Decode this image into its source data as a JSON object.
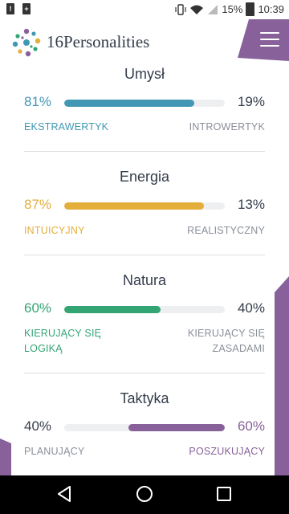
{
  "status_bar": {
    "battery": "15%",
    "time": "10:39"
  },
  "header": {
    "brand": "16Personalities"
  },
  "colors": {
    "mind": "#4298b4",
    "energy": "#e4ae3a",
    "nature": "#33a474",
    "tactics": "#88619a",
    "muted": "#8a8f99"
  },
  "traits": [
    {
      "title": "Umysł",
      "left_pct": "81%",
      "right_pct": "19%",
      "fill": 0.81,
      "fill_side": "left",
      "left_label": "EKSTRAWERTYK",
      "right_label": "INTROWERTYK"
    },
    {
      "title": "Energia",
      "left_pct": "87%",
      "right_pct": "13%",
      "fill": 0.87,
      "fill_side": "left",
      "left_label": "INTUICYJNY",
      "right_label": "REALISTYCZNY"
    },
    {
      "title": "Natura",
      "left_pct": "60%",
      "right_pct": "40%",
      "fill": 0.6,
      "fill_side": "left",
      "left_label_lines": [
        "KIERUJĄCY SIĘ",
        "LOGIKĄ"
      ],
      "right_label_lines": [
        "KIERUJĄCY SIĘ",
        "ZASADAMI"
      ]
    },
    {
      "title": "Taktyka",
      "left_pct": "40%",
      "right_pct": "60%",
      "fill": 0.6,
      "fill_side": "right",
      "left_label": "PLANUJĄCY",
      "right_label": "POSZUKUJĄCY"
    }
  ]
}
